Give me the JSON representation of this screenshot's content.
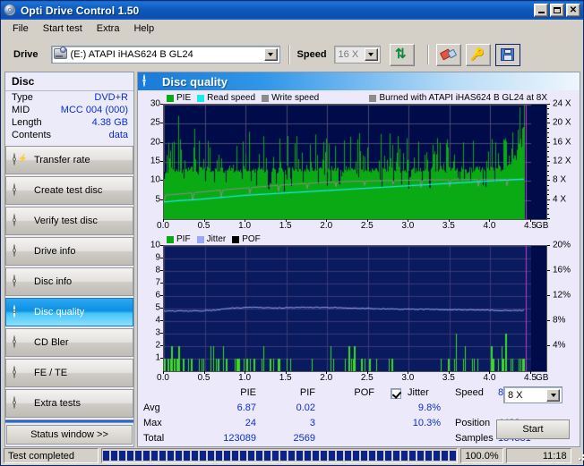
{
  "window": {
    "title": "Opti Drive Control 1.50",
    "icon": "cd-disc-icon",
    "buttons": {
      "minimize": "minimize",
      "maximize": "maximize",
      "close": "close"
    }
  },
  "menu": {
    "items": [
      "File",
      "Start test",
      "Extra",
      "Help"
    ]
  },
  "toolbar": {
    "drive_label": "Drive",
    "drive_value": "(E:)  ATAPI iHAS624   B GL24",
    "speed_label": "Speed",
    "speed_value": "16 X",
    "icons": [
      "refresh-icon",
      "eraser-icon",
      "key-icon",
      "save-icon"
    ]
  },
  "sidebar": {
    "disc": {
      "header": "Disc",
      "rows": [
        {
          "key": "Type",
          "value": "DVD+R"
        },
        {
          "key": "MID",
          "value": "MCC 004 (000)"
        },
        {
          "key": "Length",
          "value": "4.38 GB"
        },
        {
          "key": "Contents",
          "value": "data"
        }
      ]
    },
    "nav": [
      {
        "label": "Transfer rate",
        "active": false
      },
      {
        "label": "Create test disc",
        "active": false
      },
      {
        "label": "Verify test disc",
        "active": false
      },
      {
        "label": "Drive info",
        "active": false
      },
      {
        "label": "Disc info",
        "active": false
      },
      {
        "label": "Disc quality",
        "active": true
      },
      {
        "label": "CD Bler",
        "active": false
      },
      {
        "label": "FE / TE",
        "active": false
      },
      {
        "label": "Extra tests",
        "active": false
      }
    ],
    "status_button": "Status window >>"
  },
  "panel": {
    "title": "Disc quality",
    "icon": "disc-quality-icon"
  },
  "stats": {
    "col_headers": [
      "PIE",
      "PIF",
      "POF",
      "Jitter"
    ],
    "row_labels": [
      "Avg",
      "Max",
      "Total"
    ],
    "pie": {
      "avg": "6.87",
      "max": "24",
      "total": "123089"
    },
    "pif": {
      "avg": "0.02",
      "max": "3",
      "total": "2569"
    },
    "pof": {
      "avg": "",
      "max": "",
      "total": ""
    },
    "jitter": {
      "checked": true,
      "avg": "9.8%",
      "max": "10.3%"
    },
    "speed_label": "Speed",
    "speed_value": "8.26 X",
    "position_label": "Position",
    "position_value": "4482",
    "samples_label": "Samples",
    "samples_value": "134331",
    "speed_select": "8 X",
    "start_button": "Start"
  },
  "statusbar": {
    "message": "Test completed",
    "percent": "100.0%",
    "time": "11:18",
    "progress": 100
  },
  "chart_data": [
    {
      "id": "top",
      "type": "area",
      "title": "",
      "xlabel": "GB",
      "ylabel": "",
      "xlim": [
        0.0,
        4.5
      ],
      "ylim": [
        0,
        30
      ],
      "y2lim": [
        0,
        24
      ],
      "y2label": "X",
      "xticks": [
        "0.0",
        "0.5",
        "1.0",
        "1.5",
        "2.0",
        "2.5",
        "3.0",
        "3.5",
        "4.0",
        "4.5"
      ],
      "xtick_values": [
        0.0,
        0.5,
        1.0,
        1.5,
        2.0,
        2.5,
        3.0,
        3.5,
        4.0,
        4.5
      ],
      "yticks": [
        "30",
        "25",
        "20",
        "15",
        "10",
        "5"
      ],
      "ytick_values": [
        30,
        25,
        20,
        15,
        10,
        5
      ],
      "y2ticks": [
        "24 X",
        "20 X",
        "16 X",
        "12 X",
        "8 X",
        "4 X"
      ],
      "y2tick_values": [
        24,
        20,
        16,
        12,
        8,
        4
      ],
      "grid": true,
      "background": "#000b4a",
      "legend": [
        {
          "label": "PIE",
          "color": "#0aaa14"
        },
        {
          "label": "Read speed",
          "color": "#1ae9f0"
        },
        {
          "label": "Write speed",
          "color": "#8c8c8c"
        }
      ],
      "annotation": {
        "label": "Burned with ATAPI iHAS624   B GL24 at 8X",
        "color": "#8c8c8c"
      },
      "data_end_gb": 4.43,
      "marker_line_gb": 4.43,
      "marker_color": "#cc33cc",
      "series": [
        {
          "name": "PIE",
          "color": "#0aaa14",
          "kind": "fill-spikes",
          "baseline": [
            12.3,
            12.8,
            13.1,
            12.6,
            13.4,
            12.2,
            13.0,
            12.9,
            13.5,
            12.4,
            13.2,
            12.7,
            13.3,
            12.5,
            13.6,
            12.8,
            13.0,
            12.6,
            13.4,
            12.9,
            13.1,
            12.3,
            13.7,
            12.8,
            13.2,
            12.5,
            13.5,
            12.9,
            13.0,
            12.6,
            13.3,
            12.7,
            13.1,
            12.4,
            13.6,
            12.8,
            13.2,
            12.9,
            13.4,
            12.5,
            13.0,
            12.7,
            13.5,
            12.8,
            13.1,
            12.6,
            13.3,
            12.9,
            13.0,
            12.4,
            13.4,
            12.8,
            13.2,
            12.5,
            13.6,
            12.9,
            13.1,
            12.7,
            13.3,
            12.6,
            13.0,
            12.8,
            13.5,
            12.4,
            13.2,
            12.9,
            13.1,
            12.5,
            13.4,
            12.7,
            13.0,
            12.6,
            13.3,
            12.8,
            13.2,
            12.9,
            13.5,
            12.4,
            13.1,
            12.7,
            13.0,
            12.8,
            13.4,
            12.5,
            13.2,
            12.6,
            13.3,
            12.9,
            13.0,
            13.1,
            13.4,
            13.0,
            13.6,
            13.2,
            13.8,
            14.1,
            14.6,
            15.4,
            16.8,
            18.2
          ],
          "avg": 6.87,
          "max": 24
        },
        {
          "name": "Read speed",
          "color": "#1ae9f0",
          "kind": "line-axis2",
          "points_x": [
            0.0,
            0.2,
            0.4,
            0.6,
            0.8,
            1.0,
            1.3,
            1.6,
            1.9,
            2.2,
            2.5,
            2.8,
            3.1,
            3.4,
            3.7,
            4.0,
            4.3,
            4.43
          ],
          "points_y": [
            3.6,
            3.9,
            4.1,
            4.4,
            4.7,
            5.0,
            5.3,
            5.6,
            5.9,
            6.2,
            6.5,
            6.8,
            7.1,
            7.4,
            7.7,
            8.0,
            8.3,
            8.4
          ]
        },
        {
          "name": "Write speed",
          "color": "#8c8c8c",
          "kind": "line-axis2-sawtooth",
          "points_x": [
            0.0,
            0.35,
            0.7,
            1.05,
            1.4,
            1.75,
            2.1,
            2.45,
            2.8,
            3.15,
            3.5,
            3.85,
            4.2,
            4.43
          ],
          "points_y": [
            5.0,
            5.5,
            6.1,
            6.6,
            7.1,
            7.5,
            7.8,
            8.0,
            8.1,
            8.2,
            8.25,
            8.3,
            8.3,
            8.3
          ]
        }
      ]
    },
    {
      "id": "bottom",
      "type": "area",
      "title": "",
      "xlabel": "GB",
      "xlim": [
        0.0,
        4.5
      ],
      "ylim": [
        0,
        10
      ],
      "y2lim": [
        0,
        20
      ],
      "y2label": "%",
      "xticks": [
        "0.0",
        "0.5",
        "1.0",
        "1.5",
        "2.0",
        "2.5",
        "3.0",
        "3.5",
        "4.0",
        "4.5"
      ],
      "xtick_values": [
        0.0,
        0.5,
        1.0,
        1.5,
        2.0,
        2.5,
        3.0,
        3.5,
        4.0,
        4.5
      ],
      "yticks": [
        "10",
        "9",
        "8",
        "7",
        "6",
        "5",
        "4",
        "3",
        "2",
        "1"
      ],
      "ytick_values": [
        10,
        9,
        8,
        7,
        6,
        5,
        4,
        3,
        2,
        1
      ],
      "y2ticks": [
        "20%",
        "16%",
        "12%",
        "8%",
        "4%"
      ],
      "y2tick_values": [
        20,
        16,
        12,
        8,
        4
      ],
      "grid": true,
      "background": "#0a1a5e",
      "legend": [
        {
          "label": "PIF",
          "color": "#0aaa14"
        },
        {
          "label": "Jitter",
          "color": "#9aa8f5"
        },
        {
          "label": "POF",
          "color": "#000000"
        }
      ],
      "data_end_gb": 4.43,
      "marker_line_gb": 4.43,
      "marker_color": "#cc33cc",
      "series": [
        {
          "name": "PIF",
          "color": "#3ddb22",
          "kind": "spikes",
          "max": 3,
          "avg": 0.02,
          "total": 2569
        },
        {
          "name": "Jitter",
          "color": "#9aa8f5",
          "kind": "line-axis2",
          "avg_pct": 9.8,
          "max_pct": 10.3,
          "points_x": [
            0.0,
            0.3,
            0.6,
            0.85,
            1.1,
            1.4,
            1.7,
            2.0,
            2.3,
            2.6,
            2.9,
            3.2,
            3.5,
            3.8,
            4.1,
            4.43
          ],
          "points_y": [
            9.6,
            9.6,
            9.7,
            10.1,
            10.2,
            10.1,
            10.2,
            10.2,
            10.1,
            10.0,
            9.9,
            9.9,
            9.8,
            9.8,
            9.7,
            9.7
          ]
        }
      ]
    }
  ]
}
